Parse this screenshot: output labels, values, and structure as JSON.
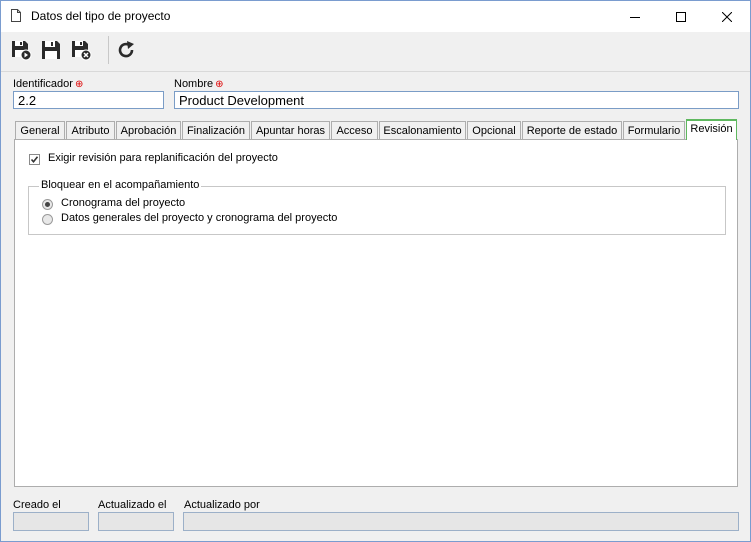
{
  "window": {
    "title": "Datos del tipo de proyecto",
    "controls": [
      "minimize-icon",
      "maximize-icon",
      "close-icon"
    ]
  },
  "toolbar": {
    "buttons": [
      {
        "icon": "save-and-new-icon"
      },
      {
        "icon": "save-icon"
      },
      {
        "icon": "save-and-close-icon"
      },
      {
        "icon": "refresh-icon"
      }
    ]
  },
  "form": {
    "identificador_label": "Identificador",
    "identificador_value": "2.2",
    "nombre_label": "Nombre",
    "nombre_value": "Product Development",
    "required_mark": "⊕"
  },
  "tabs": [
    {
      "label": "General"
    },
    {
      "label": "Atributo"
    },
    {
      "label": "Aprobación"
    },
    {
      "label": "Finalización"
    },
    {
      "label": "Apuntar horas"
    },
    {
      "label": "Acceso"
    },
    {
      "label": "Escalonamiento"
    },
    {
      "label": "Opcional"
    },
    {
      "label": "Reporte de estado"
    },
    {
      "label": "Formulario"
    },
    {
      "label": "Revisión",
      "active": true
    }
  ],
  "revision": {
    "checkbox_label": "Exigir revisión para replanificación del proyecto",
    "checkbox_checked": true,
    "group_title": "Bloquear en el acompañamiento",
    "options": [
      {
        "label": "Cronograma del proyecto",
        "selected": true
      },
      {
        "label": "Datos generales del proyecto y cronograma del proyecto",
        "selected": false
      }
    ]
  },
  "footer": {
    "creado_label": "Creado el",
    "creado_value": "",
    "actualizado_label": "Actualizado el",
    "actualizado_value": "",
    "actualizado_por_label": "Actualizado por",
    "actualizado_por_value": ""
  },
  "colors": {
    "active_tab_accent": "#5fb85f",
    "required": "#dd0000",
    "window_border": "#7a9ccf"
  }
}
